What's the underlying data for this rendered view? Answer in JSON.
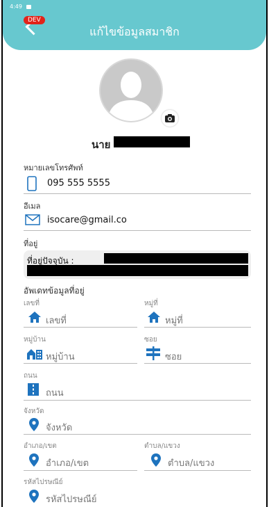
{
  "status": {
    "time": "4:49"
  },
  "header": {
    "title": "แก้ไขข้อมูลสมาชิก",
    "dev_badge": "DEV"
  },
  "profile": {
    "prefix": "นาย"
  },
  "phone": {
    "label": "หมายเลขโทรศัพท์",
    "value": "095 555 5555"
  },
  "email": {
    "label": "อีเมล",
    "value": "isocare@gmail.co"
  },
  "address": {
    "label": "ที่อยู่",
    "current_label": "ที่อยู่ปัจจุบัน :"
  },
  "update": {
    "title": "อัพเดทข้อมูลที่อยู่",
    "house_no": {
      "label": "เลขที่",
      "placeholder": "เลขที่"
    },
    "moo": {
      "label": "หมู่ที่",
      "placeholder": "หมู่ที่"
    },
    "village": {
      "label": "หมู่บ้าน",
      "placeholder": "หมู่บ้าน"
    },
    "soi": {
      "label": "ซอย",
      "placeholder": "ซอย"
    },
    "road": {
      "label": "ถนน",
      "placeholder": "ถนน"
    },
    "province": {
      "label": "จังหวัด",
      "placeholder": "จังหวัด"
    },
    "district": {
      "label": "อำเภอ/เขต",
      "placeholder": "อำเภอ/เขต"
    },
    "subdistrict": {
      "label": "ตำบล/แขวง",
      "placeholder": "ตำบล/แขวง"
    },
    "postcode": {
      "label": "รหัสไปรษณีย์",
      "placeholder": "รหัสไปรษณีย์"
    }
  },
  "colors": {
    "accent": "#67c8cf",
    "icon_blue": "#1e73be",
    "dev_red": "#e2231a"
  }
}
